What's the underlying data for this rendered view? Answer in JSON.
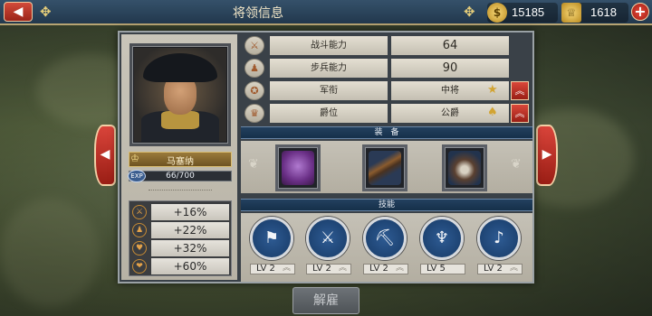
{
  "header": {
    "back_icon": "back-arrow-icon",
    "title": "将领信息",
    "gold": "15185",
    "medals": "1618",
    "add_label": "+"
  },
  "general": {
    "name": "马塞纳",
    "exp_label": "EXP",
    "exp_text": "66/700",
    "exp_progress": 0.094
  },
  "bonuses": [
    {
      "icon": "sword-icon",
      "value": "+16%"
    },
    {
      "icon": "infantry-icon",
      "value": "+22%"
    },
    {
      "icon": "shield-heart-icon",
      "value": "+32%"
    },
    {
      "icon": "heart-icon",
      "value": "+60%"
    }
  ],
  "stats": [
    {
      "icon": "crossed-swords-icon",
      "label": "战斗能力",
      "value": "64"
    },
    {
      "icon": "infantry-icon",
      "label": "步兵能力",
      "value": "90"
    },
    {
      "icon": "rank-icon",
      "label": "军衔",
      "value": "中将"
    },
    {
      "icon": "crown-icon",
      "label": "爵位",
      "value": "公爵"
    }
  ],
  "sections": {
    "equipment": "装　备",
    "skills": "技能"
  },
  "equipment": [
    {
      "name": "purple-heart-medal"
    },
    {
      "name": "musket"
    },
    {
      "name": "backpack"
    }
  ],
  "skills": [
    {
      "icon": "infantry-march-icon",
      "level": "LV 2"
    },
    {
      "icon": "volley-fire-icon",
      "level": "LV 2"
    },
    {
      "icon": "trench-icon",
      "level": "LV 2"
    },
    {
      "icon": "torch-icon",
      "level": "LV 5"
    },
    {
      "icon": "bugle-icon",
      "level": "LV 2"
    }
  ],
  "footer": {
    "dismiss_label": "解雇"
  },
  "colors": {
    "accent_red": "#c0392b",
    "gold": "#e8cf7a",
    "header_blue": "#2b4560"
  }
}
